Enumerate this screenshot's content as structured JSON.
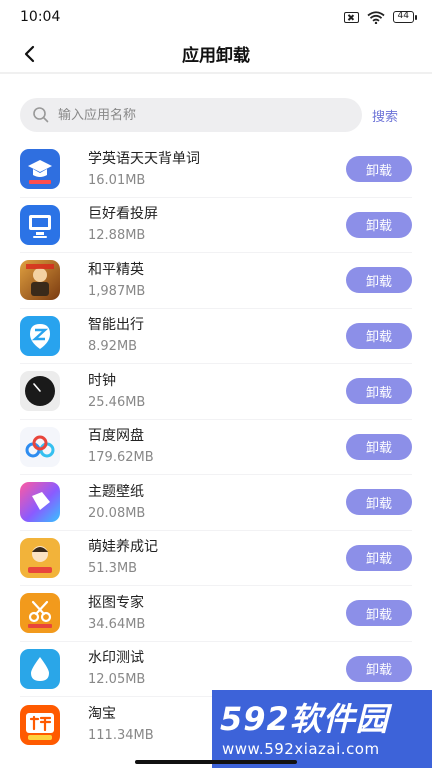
{
  "status_bar": {
    "time": "10:04",
    "battery": "44"
  },
  "header": {
    "title": "应用卸载"
  },
  "search": {
    "placeholder": "输入应用名称",
    "button_label": "搜索"
  },
  "uninstall_label": "卸载",
  "apps": [
    {
      "name": "学英语天天背单词",
      "size": "16.01MB",
      "icon": "graduation-cap-icon",
      "color": "#2f6fe0"
    },
    {
      "name": "巨好看投屏",
      "size": "12.88MB",
      "icon": "screen-cast-icon",
      "color": "#2b73e6"
    },
    {
      "name": "和平精英",
      "size": "1,987MB",
      "icon": "game-character-icon",
      "color": "#c87a1f"
    },
    {
      "name": "智能出行",
      "size": "8.92MB",
      "icon": "location-pin-icon",
      "color": "#28a3ee"
    },
    {
      "name": "时钟",
      "size": "25.46MB",
      "icon": "clock-icon",
      "color": "#1a1a1a"
    },
    {
      "name": "百度网盘",
      "size": "179.62MB",
      "icon": "cloud-icon",
      "color": "#2d8cf0"
    },
    {
      "name": "主题壁纸",
      "size": "20.08MB",
      "icon": "brush-icon",
      "color": "#8a5bff"
    },
    {
      "name": "萌娃养成记",
      "size": "51.3MB",
      "icon": "cartoon-icon",
      "color": "#f2b33a"
    },
    {
      "name": "抠图专家",
      "size": "34.64MB",
      "icon": "scissors-icon",
      "color": "#f29a1c"
    },
    {
      "name": "水印测试",
      "size": "12.05MB",
      "icon": "water-drop-icon",
      "color": "#2aa6e8"
    },
    {
      "name": "淘宝",
      "size": "111.34MB",
      "icon": "taobao-logo-icon",
      "color": "#ff5a00"
    }
  ],
  "watermark": {
    "text": "592软件园",
    "url": "www.592xiazai.com"
  }
}
